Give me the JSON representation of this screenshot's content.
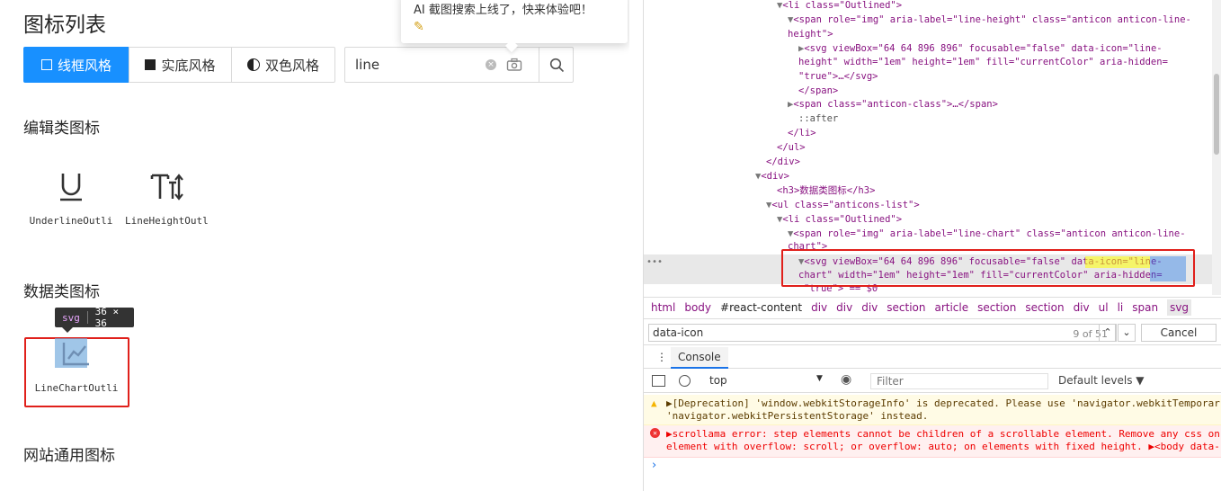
{
  "page": {
    "title": "图标列表"
  },
  "theme_tabs": [
    {
      "label": "线框风格",
      "icon": "outline-square-icon",
      "active": true
    },
    {
      "label": "实底风格",
      "icon": "filled-square-icon",
      "active": false
    },
    {
      "label": "双色风格",
      "icon": "half-circle-icon",
      "active": false
    }
  ],
  "search": {
    "value": "line"
  },
  "popup": {
    "text": "AI 截图搜索上线了，快来体验吧！"
  },
  "sections": {
    "edit": "编辑类图标",
    "data": "数据类图标",
    "site": "网站通用图标"
  },
  "icons": {
    "underline": "UnderlineOutli",
    "line_height": "LineHeightOutl",
    "line_chart": "LineChartOutli"
  },
  "tooltip": {
    "tag": "svg",
    "size": "36 × 36"
  },
  "devtools": {
    "dom_lines": [
      "<li class=\"Outlined\">",
      "<span role=\"img\" aria-label=\"line-height\" class=\"anticon anticon-line-",
      "height\">",
      "<svg viewBox=\"64 64 896 896\" focusable=\"false\" data-icon=\"line-",
      "height\" width=\"1em\" height=\"1em\" fill=\"currentColor\" aria-hidden=",
      "\"true\">…</svg>",
      "</span>",
      "<span class=\"anticon-class\">…</span>",
      "::after",
      "</li>",
      "</ul>",
      "</div>",
      "<div>",
      "<h3>数据类图标</h3>",
      "<ul class=\"anticons-list\">",
      "<li class=\"Outlined\">",
      "<span role=\"img\" aria-label=\"line-chart\" class=\"anticon anticon-line-",
      "chart\">",
      "<svg viewBox=\"64 64 896 896\" focusable=\"false\" data-icon=\"line-",
      "chart\" width=\"1em\" height=\"1em\" fill=\"currentColor\" aria-hidden=",
      "\"true\"> == $0"
    ],
    "breadcrumbs": [
      "html",
      "body",
      "#react-content",
      "div",
      "div",
      "div",
      "section",
      "article",
      "section",
      "section",
      "div",
      "ul",
      "li",
      "span",
      "svg"
    ],
    "find": {
      "value": "data-icon",
      "count": "9 of 51",
      "cancel": "Cancel"
    },
    "console_tab": "Console",
    "context": "top",
    "filter_placeholder": "Filter",
    "levels": "Default levels ▼",
    "messages": [
      {
        "type": "warning",
        "line1": "▶[Deprecation] 'window.webkitStorageInfo' is deprecated. Please use 'navigator.webkitTemporar",
        "line2": "'navigator.webkitPersistentStorage' instead."
      },
      {
        "type": "error",
        "line1": "▶scrollama error: step elements cannot be children of a scrollable element. Remove any css on",
        "line2": "element with overflow: scroll; or overflow: auto; on elements with fixed height.  ▶<body data-"
      }
    ]
  },
  "colors": {
    "accent": "#1890ff",
    "highlight_red": "#e0201b"
  }
}
